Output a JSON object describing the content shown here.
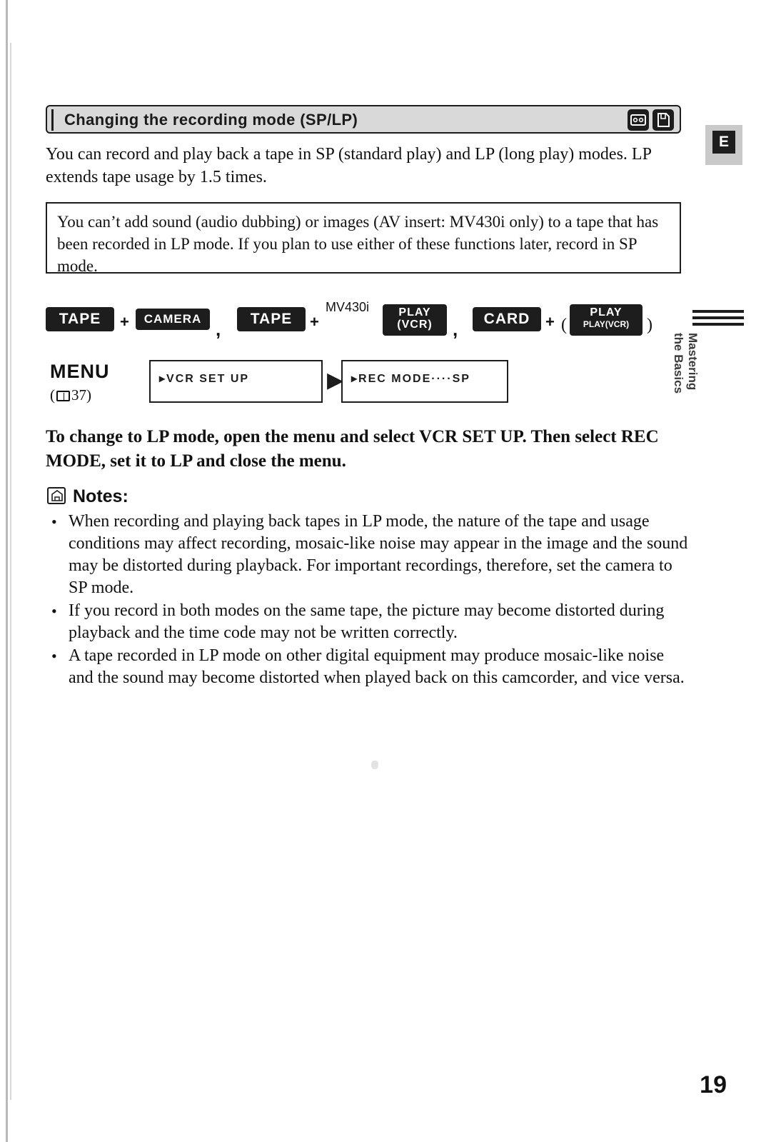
{
  "header": {
    "title": "Changing the recording mode (SP/LP)",
    "icons": [
      "tape-icon",
      "card-icon"
    ],
    "tab_letter": "E"
  },
  "side_label": "Mastering\nthe Basics",
  "side_label_line1": "Mastering",
  "side_label_line2": "the Basics",
  "intro": "You can record and play back a tape in SP (standard play) and LP (long play) modes. LP extends tape usage by 1.5 times.",
  "caution": "You can’t add sound (audio dubbing) or images (AV insert: MV430i only) to a tape that has been recorded in LP mode. If you plan to use either of these functions later, record in SP mode.",
  "badges": {
    "tape1": "TAPE",
    "plus1": "+",
    "camera": "CAMERA",
    "comma1": ",",
    "tape2": "TAPE",
    "plus2": "+",
    "mv430i": "MV430i",
    "play_vcr_line1": "PLAY",
    "play_vcr_line2": "(VCR)",
    "comma2": ",",
    "card": "CARD",
    "plus3": "+",
    "paren_open": "(",
    "play": "PLAY",
    "play_vcr_small": "PLAY(VCR)",
    "paren_close": ")"
  },
  "menu": {
    "label": "MENU",
    "ref_open": "(",
    "ref_page": "37)",
    "step1": "▸VCR SET UP",
    "arrow": "▶",
    "step2": "▸REC MODE····SP"
  },
  "instruction": "To change to LP mode, open the menu and select VCR SET UP. Then select REC MODE, set it to LP and close the menu.",
  "notes": {
    "title": "Notes:",
    "items": [
      "When recording and playing back tapes in LP mode, the nature of the tape and usage conditions may affect recording, mosaic-like noise may appear in the image and the sound may be distorted during playback. For important recordings, therefore, set the camera to SP mode.",
      "If you record in both modes on the same tape, the picture may become distorted during playback and the time code may not be written correctly.",
      "A tape recorded in LP mode on other digital equipment may produce mosaic-like noise and the sound may become distorted when played back on this camcorder, and vice versa."
    ]
  },
  "page_number": "19"
}
